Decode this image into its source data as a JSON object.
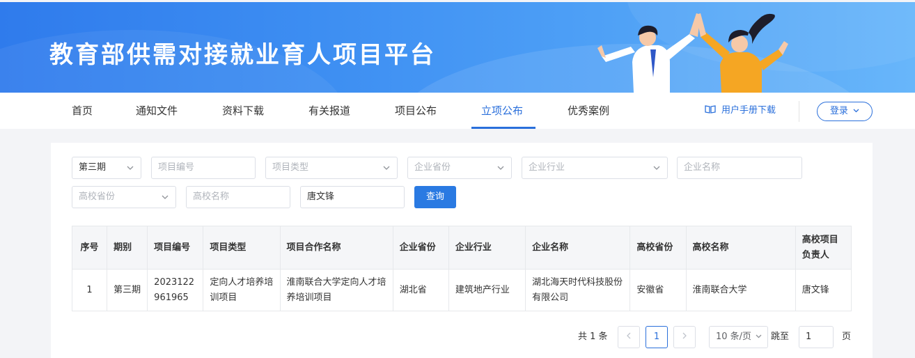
{
  "banner": {
    "title": "教育部供需对接就业育人项目平台"
  },
  "nav": {
    "items": [
      {
        "label": "首页",
        "active": false
      },
      {
        "label": "通知文件",
        "active": false
      },
      {
        "label": "资料下载",
        "active": false
      },
      {
        "label": "有关报道",
        "active": false
      },
      {
        "label": "项目公布",
        "active": false
      },
      {
        "label": "立项公布",
        "active": true
      },
      {
        "label": "优秀案例",
        "active": false
      }
    ],
    "manual_label": "用户手册下载",
    "manual_icon": "book-icon",
    "login_label": "登录",
    "accent": "#2a6fdb"
  },
  "filters": {
    "period": "第三期",
    "project_no_placeholder": "项目编号",
    "project_type_placeholder": "项目类型",
    "company_province_placeholder": "企业省份",
    "company_industry_placeholder": "企业行业",
    "company_name_placeholder": "企业名称",
    "school_province_placeholder": "高校省份",
    "school_name_placeholder": "高校名称",
    "leader_value": "唐文锋",
    "query_label": "查询"
  },
  "table": {
    "headers": [
      "序号",
      "期别",
      "项目编号",
      "项目类型",
      "项目合作名称",
      "企业省份",
      "企业行业",
      "企业名称",
      "高校省份",
      "高校名称",
      "高校项目负责人"
    ],
    "rows": [
      [
        "1",
        "第三期",
        "2023122961965",
        "定向人才培养培训项目",
        "淮南联合大学定向人才培养培训项目",
        "湖北省",
        "建筑地产行业",
        "湖北海天时代科技股份有限公司",
        "安徽省",
        "淮南联合大学",
        "唐文锋"
      ]
    ]
  },
  "pagination": {
    "total_label": "共 1 条",
    "current_page": "1",
    "page_size": "10 条/页",
    "jump_label": "跳至",
    "jump_value": "1",
    "page_suffix": "页"
  }
}
